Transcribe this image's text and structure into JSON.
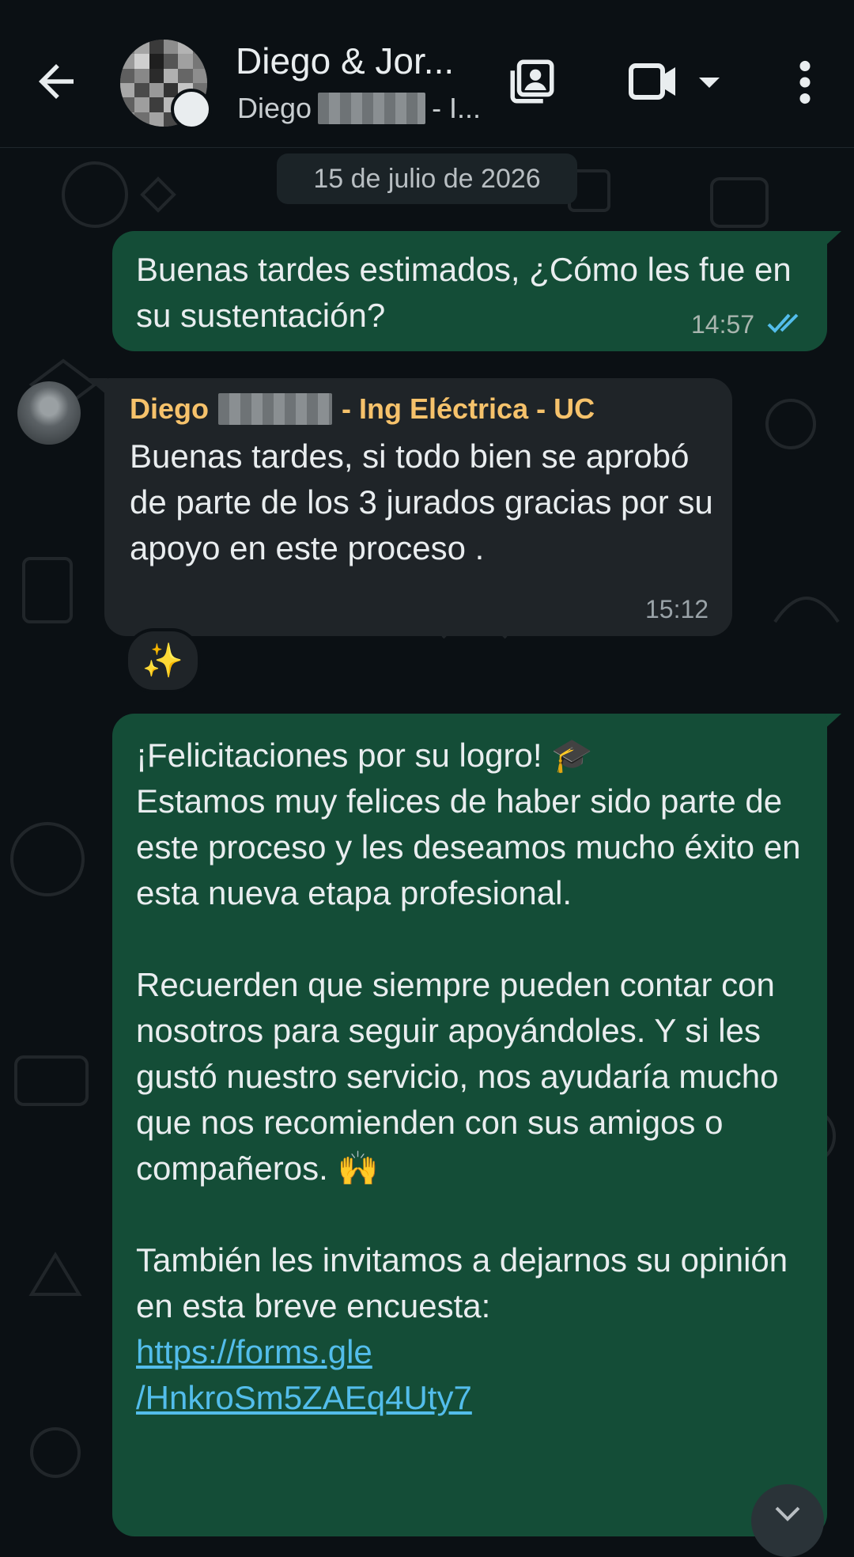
{
  "header": {
    "title": "Diego & Jor...",
    "subtitle_prefix": "Diego",
    "subtitle_suffix": "- I...",
    "icons": [
      "back-arrow-icon",
      "group-avatar",
      "contacts-icon",
      "video-call-icon",
      "dropdown-caret-icon",
      "more-options-icon"
    ]
  },
  "date_chip": "15 de julio de 2026",
  "messages": [
    {
      "direction": "outgoing",
      "text": "Buenas tardes estimados, ¿Cómo les fue en su sustentación?",
      "time": "14:57",
      "status": "read"
    },
    {
      "direction": "incoming",
      "sender_prefix": "Diego",
      "sender_suffix": "- Ing Eléctrica - UC",
      "text": "Buenas tardes, si todo bien se aprobó de parte de los 3 jurados gracias por su apoyo en este proceso .",
      "time": "15:12",
      "reaction": "✨"
    },
    {
      "direction": "outgoing",
      "line1": "¡Felicitaciones por su logro!",
      "emoji1": "🎓",
      "para1": "Estamos muy felices de haber sido parte de este proceso y les deseamos mucho éxito en esta nueva etapa profesional.",
      "para2": "Recuerden que siempre pueden contar con nosotros para seguir apoyándoles. Y si les gustó nuestro servicio, nos ayudaría mucho que nos recomienden con sus amigos o compañeros.",
      "emoji2": "🙌",
      "para3": "También les invitamos a dejarnos su opinión en esta breve encuesta:",
      "link_line1": "https://forms.gle",
      "link_line2": "/HnkroSm5ZAEq4Uty7"
    }
  ],
  "colors": {
    "background": "#0b1014",
    "outgoing_bubble": "#144d37",
    "incoming_bubble": "#1f2428",
    "sender_name": "#f6c26b",
    "link": "#53bdeb",
    "read_ticks": "#53bdeb"
  }
}
